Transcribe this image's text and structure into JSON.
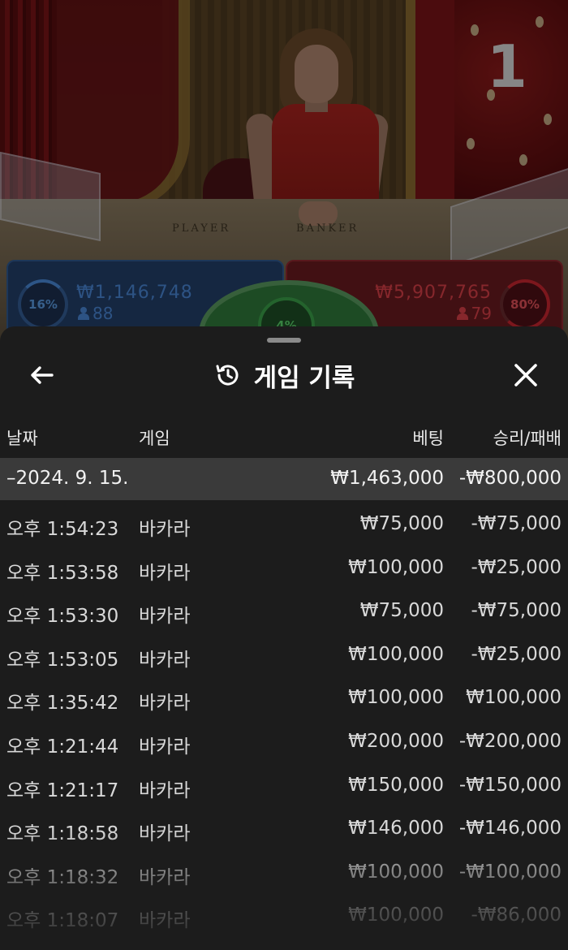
{
  "video": {
    "table_number": "1",
    "table_labels": {
      "player": "PLAYER",
      "banker": "BANKER"
    },
    "player": {
      "percent": "16%",
      "amount": "₩1,146,748",
      "players": "88",
      "color": "#2f5a90"
    },
    "banker": {
      "percent": "80%",
      "amount": "₩5,907,765",
      "players": "79",
      "color": "#902830"
    },
    "tie": {
      "percent": "4%",
      "color": "#3aa04a"
    }
  },
  "history": {
    "title": "게임 기록",
    "icons": {
      "back": "arrow-left-icon",
      "history": "history-clock-icon",
      "close": "close-icon"
    },
    "columns": {
      "date": "날짜",
      "game": "게임",
      "bet": "베팅",
      "result": "승리/패배"
    },
    "group": {
      "date": "–2024. 9. 15.",
      "bet": "₩1,463,000",
      "result": "-₩800,000"
    },
    "rows": [
      {
        "time": "오후 1:54:23",
        "game": "바카라",
        "bet": "₩75,000",
        "result": "-₩75,000"
      },
      {
        "time": "오후 1:53:58",
        "game": "바카라",
        "bet": "₩100,000",
        "result": "-₩25,000"
      },
      {
        "time": "오후 1:53:30",
        "game": "바카라",
        "bet": "₩75,000",
        "result": "-₩75,000"
      },
      {
        "time": "오후 1:53:05",
        "game": "바카라",
        "bet": "₩100,000",
        "result": "-₩25,000"
      },
      {
        "time": "오후 1:35:42",
        "game": "바카라",
        "bet": "₩100,000",
        "result": "₩100,000"
      },
      {
        "time": "오후 1:21:44",
        "game": "바카라",
        "bet": "₩200,000",
        "result": "-₩200,000"
      },
      {
        "time": "오후 1:21:17",
        "game": "바카라",
        "bet": "₩150,000",
        "result": "-₩150,000"
      },
      {
        "time": "오후 1:18:58",
        "game": "바카라",
        "bet": "₩146,000",
        "result": "-₩146,000"
      },
      {
        "time": "오후 1:18:32",
        "game": "바카라",
        "bet": "₩100,000",
        "result": "-₩100,000"
      },
      {
        "time": "오후 1:18:07",
        "game": "바카라",
        "bet": "₩100,000",
        "result": "-₩86,000"
      }
    ]
  }
}
